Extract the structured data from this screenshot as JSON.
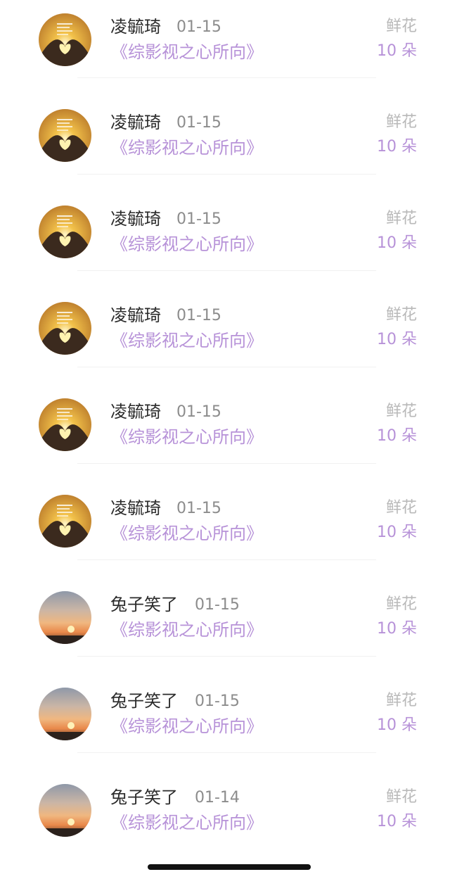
{
  "gifts": [
    {
      "user": "凌毓琦",
      "date": "01-15",
      "work": "《综影视之心所向》",
      "gift_name": "鲜花",
      "gift_count": "10 朵",
      "avatar": "heart-hands-sunset"
    },
    {
      "user": "凌毓琦",
      "date": "01-15",
      "work": "《综影视之心所向》",
      "gift_name": "鲜花",
      "gift_count": "10 朵",
      "avatar": "heart-hands-sunset"
    },
    {
      "user": "凌毓琦",
      "date": "01-15",
      "work": "《综影视之心所向》",
      "gift_name": "鲜花",
      "gift_count": "10 朵",
      "avatar": "heart-hands-sunset"
    },
    {
      "user": "凌毓琦",
      "date": "01-15",
      "work": "《综影视之心所向》",
      "gift_name": "鲜花",
      "gift_count": "10 朵",
      "avatar": "heart-hands-sunset"
    },
    {
      "user": "凌毓琦",
      "date": "01-15",
      "work": "《综影视之心所向》",
      "gift_name": "鲜花",
      "gift_count": "10 朵",
      "avatar": "heart-hands-sunset"
    },
    {
      "user": "凌毓琦",
      "date": "01-15",
      "work": "《综影视之心所向》",
      "gift_name": "鲜花",
      "gift_count": "10 朵",
      "avatar": "heart-hands-sunset"
    },
    {
      "user": "兔子笑了",
      "date": "01-15",
      "work": "《综影视之心所向》",
      "gift_name": "鲜花",
      "gift_count": "10 朵",
      "avatar": "sunset-sky"
    },
    {
      "user": "兔子笑了",
      "date": "01-15",
      "work": "《综影视之心所向》",
      "gift_name": "鲜花",
      "gift_count": "10 朵",
      "avatar": "sunset-sky"
    },
    {
      "user": "兔子笑了",
      "date": "01-14",
      "work": "《综影视之心所向》",
      "gift_name": "鲜花",
      "gift_count": "10 朵",
      "avatar": "sunset-sky"
    }
  ],
  "colors": {
    "accent": "#b792d8",
    "name": "#2b2b2b",
    "date": "#8c8c8c",
    "muted": "#b9b9b9"
  }
}
